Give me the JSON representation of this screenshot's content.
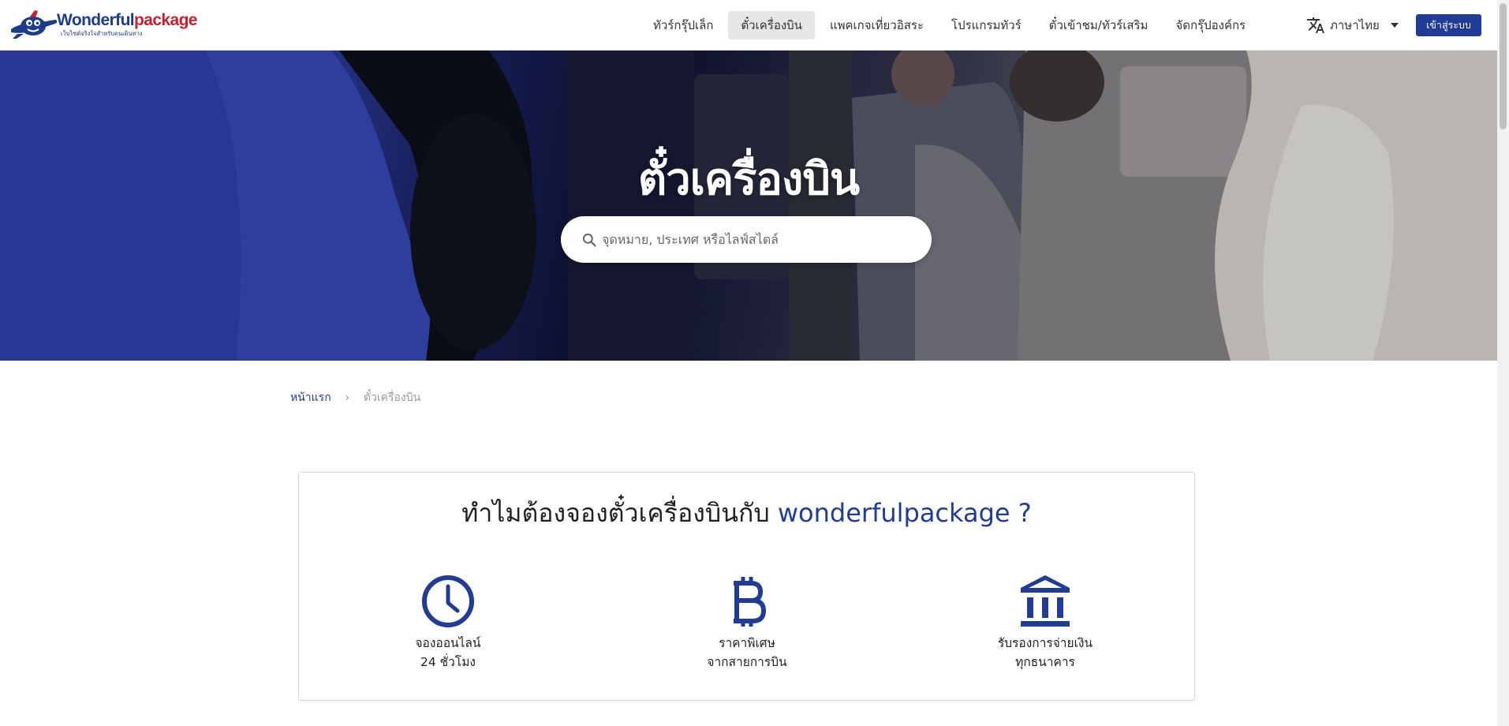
{
  "header": {
    "logo": {
      "brand_part1": "Wonderful",
      "brand_part2": "package",
      "tagline": "เว็บไซต์จริงใจสำหรับคนเดินทาง"
    },
    "nav": [
      {
        "label": "ทัวร์กรุ๊ปเล็ก",
        "active": false
      },
      {
        "label": "ตั๋วเครื่องบิน",
        "active": true
      },
      {
        "label": "แพคเกจเที่ยวอิสระ",
        "active": false
      },
      {
        "label": "โปรแกรมทัวร์",
        "active": false
      },
      {
        "label": "ตั๋วเข้าชม/ทัวร์เสริม",
        "active": false
      },
      {
        "label": "จัดกรุ๊ปองค์กร",
        "active": false
      }
    ],
    "language": {
      "label": "ภาษาไทย",
      "icon": "translate-icon"
    },
    "login_label": "เข้าสู่ระบบ"
  },
  "hero": {
    "title": "ตั๋วเครื่องบิน",
    "search": {
      "placeholder": "จุดหมาย, ประเทศ หรือไลฟ์สไตล์",
      "value": "",
      "icon": "search-icon"
    }
  },
  "breadcrumb": {
    "home": "หน้าแรก",
    "separator": "›",
    "current": "ตั๋วเครื่องบิน"
  },
  "why": {
    "title_prefix": "ทำไมต้องจองตั๋วเครื่องบินกับ",
    "title_brand": "wonderfulpackage ?",
    "features": [
      {
        "icon": "clock-icon",
        "line1": "จองออนไลน์",
        "line2": "24 ชั่วโมง"
      },
      {
        "icon": "bitcoin-icon",
        "line1": "ราคาพิเศษ",
        "line2": "จากสายการบิน"
      },
      {
        "icon": "bank-icon",
        "line1": "รับรองการจ่ายเงิน",
        "line2": "ทุกธนาคาร"
      }
    ]
  },
  "colors": {
    "brand_blue": "#203c96",
    "brand_red": "#c8202f",
    "active_nav_bg": "#e6e6e6"
  }
}
